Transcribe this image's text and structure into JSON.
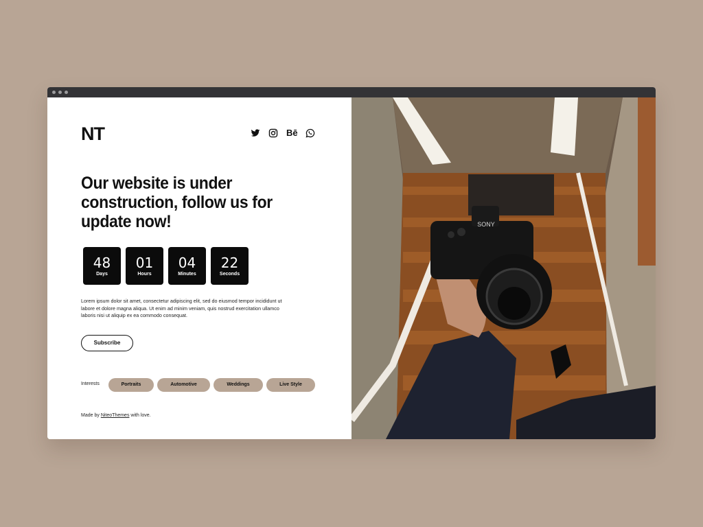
{
  "brand": {
    "logo": "NT"
  },
  "social": [
    {
      "icon": "twitter-icon"
    },
    {
      "icon": "instagram-icon"
    },
    {
      "icon": "behance-icon",
      "glyph": "Bē"
    },
    {
      "icon": "whatsapp-icon"
    }
  ],
  "hero": {
    "headline": "Our website is under construction, follow us for update now!",
    "description": "Lorem ipsum dolor sit amet, consectetur adipiscing elit, sed do eiusmod tempor incididunt ut labore et dolore magna aliqua. Ut enim ad minim veniam, quis nostrud exercitation ullamco laboris nisi ut aliquip ex ea commodo consequat."
  },
  "countdown": [
    {
      "value": "48",
      "label": "Days"
    },
    {
      "value": "01",
      "label": "Hours"
    },
    {
      "value": "04",
      "label": "Minutes"
    },
    {
      "value": "22",
      "label": "Seconds"
    }
  ],
  "subscribe_label": "Subscribe",
  "interests": {
    "label": "Interests",
    "tags": [
      "Portraits",
      "Automotive",
      "Weddings",
      "Live Style"
    ]
  },
  "footer": {
    "prefix": "Made by",
    "link": "NiteoThemes",
    "suffix": "with love."
  },
  "photo": {
    "camera_brand": "SONY"
  },
  "colors": {
    "background": "#b8a595",
    "accent": "#b8a595",
    "dark": "#0b0b0b"
  }
}
